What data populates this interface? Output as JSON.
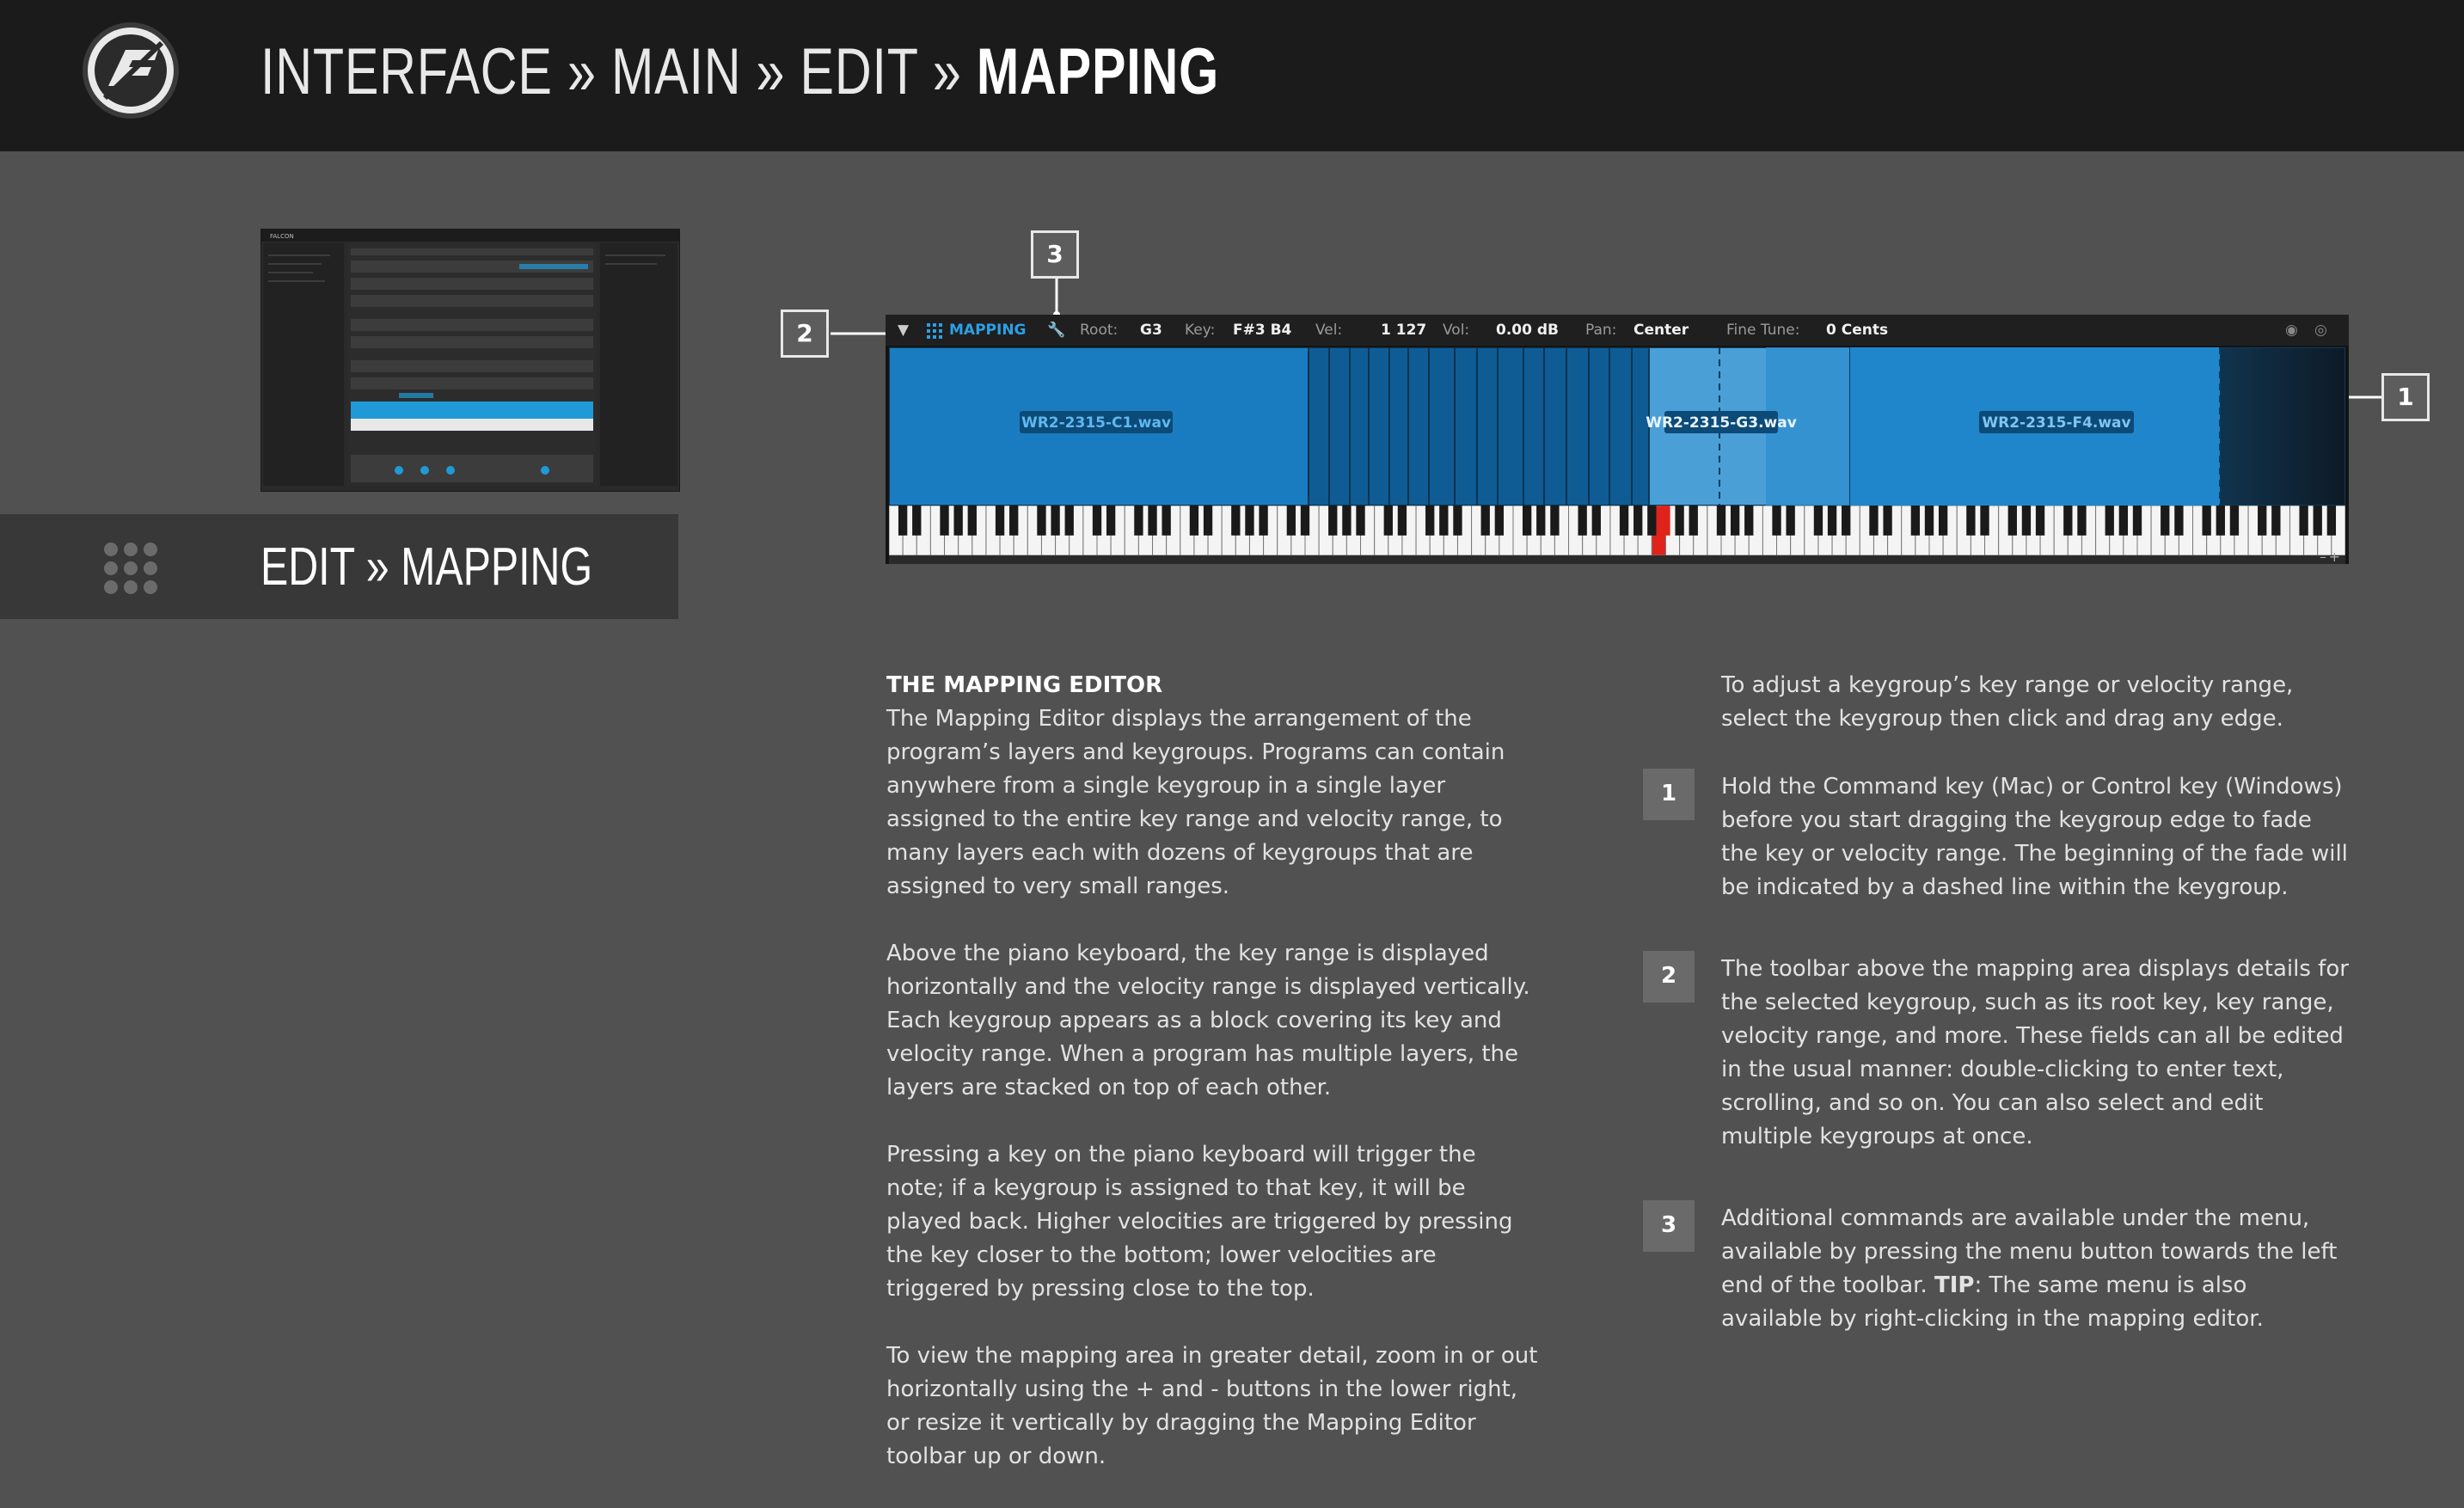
{
  "header": {
    "crumbs": [
      "INTERFACE",
      "MAIN",
      "EDIT"
    ],
    "sep": "»",
    "current": "MAPPING"
  },
  "section": {
    "title_a": "EDIT",
    "sep": "»",
    "title_b": "MAPPING"
  },
  "thumbnail": {
    "app_name": "FALCON"
  },
  "callouts": {
    "one": "1",
    "two": "2",
    "three": "3"
  },
  "editor": {
    "title": "MAPPING",
    "root_label": "Root:",
    "root_value": "G3",
    "key_label": "Key:",
    "key_value": "F#3 B4",
    "vel_label": "Vel:",
    "vel_value": "1 127",
    "vol_label": "Vol:",
    "vol_value": "0.00 dB",
    "pan_label": "Pan:",
    "pan_value": "Center",
    "tune_label": "Fine Tune:",
    "tune_value": "0 Cents",
    "keygroups": [
      "WR2-2315-C1.wav",
      "WR2-2315-G3.wav",
      "WR2-2315-F4.wav"
    ],
    "accent": "#1f8fd6"
  },
  "left_text": {
    "heading": "THE MAPPING EDITOR",
    "p1": "The Mapping Editor displays the arrangement of the program’s layers and keygroups. Programs can contain anywhere from a single keygroup in a single layer assigned to the entire key range and velocity range, to many layers each with dozens of keygroups that are assigned to very small ranges.",
    "p2": "Above the piano keyboard, the key range is displayed horizontally and the velocity range is displayed vertically. Each keygroup appears as a block covering its key and velocity range. When a program has multiple layers, the layers are stacked on top of each other.",
    "p3": "Pressing a key on the piano keyboard will trigger the note; if a keygroup is assigned to that key, it will be played back. Higher velocities are triggered by pressing the key closer to the bottom; lower velocities are triggered by pressing close to the top.",
    "p4": "To view the mapping area in greater detail, zoom in or out horizontally using the + and - buttons in the lower right, or resize it vertically by dragging the Mapping Editor toolbar up or down."
  },
  "right_text": {
    "intro": "To adjust a keygroup’s key range or velocity range, select the keygroup then click and drag any edge.",
    "items": [
      {
        "num": "1",
        "text": "Hold the Command key (Mac) or Control key (Windows) before you start dragging the keygroup edge to fade the key or velocity range. The beginning of the fade will be indicated by a dashed line within the keygroup."
      },
      {
        "num": "2",
        "text": "The toolbar above the mapping area displays details for the selected keygroup, such as its root key, key range, velocity range, and more. These fields can all be edited in the usual manner: double-clicking to enter text, scrolling, and so on. You can also select and edit multiple keygroups at once."
      },
      {
        "num": "3",
        "pre": "Additional commands are available under the menu, available by pressing the menu button towards the left end of the toolbar. ",
        "tip": "TIP",
        "post": ": The same menu is also available by right-clicking in the mapping editor."
      }
    ]
  }
}
